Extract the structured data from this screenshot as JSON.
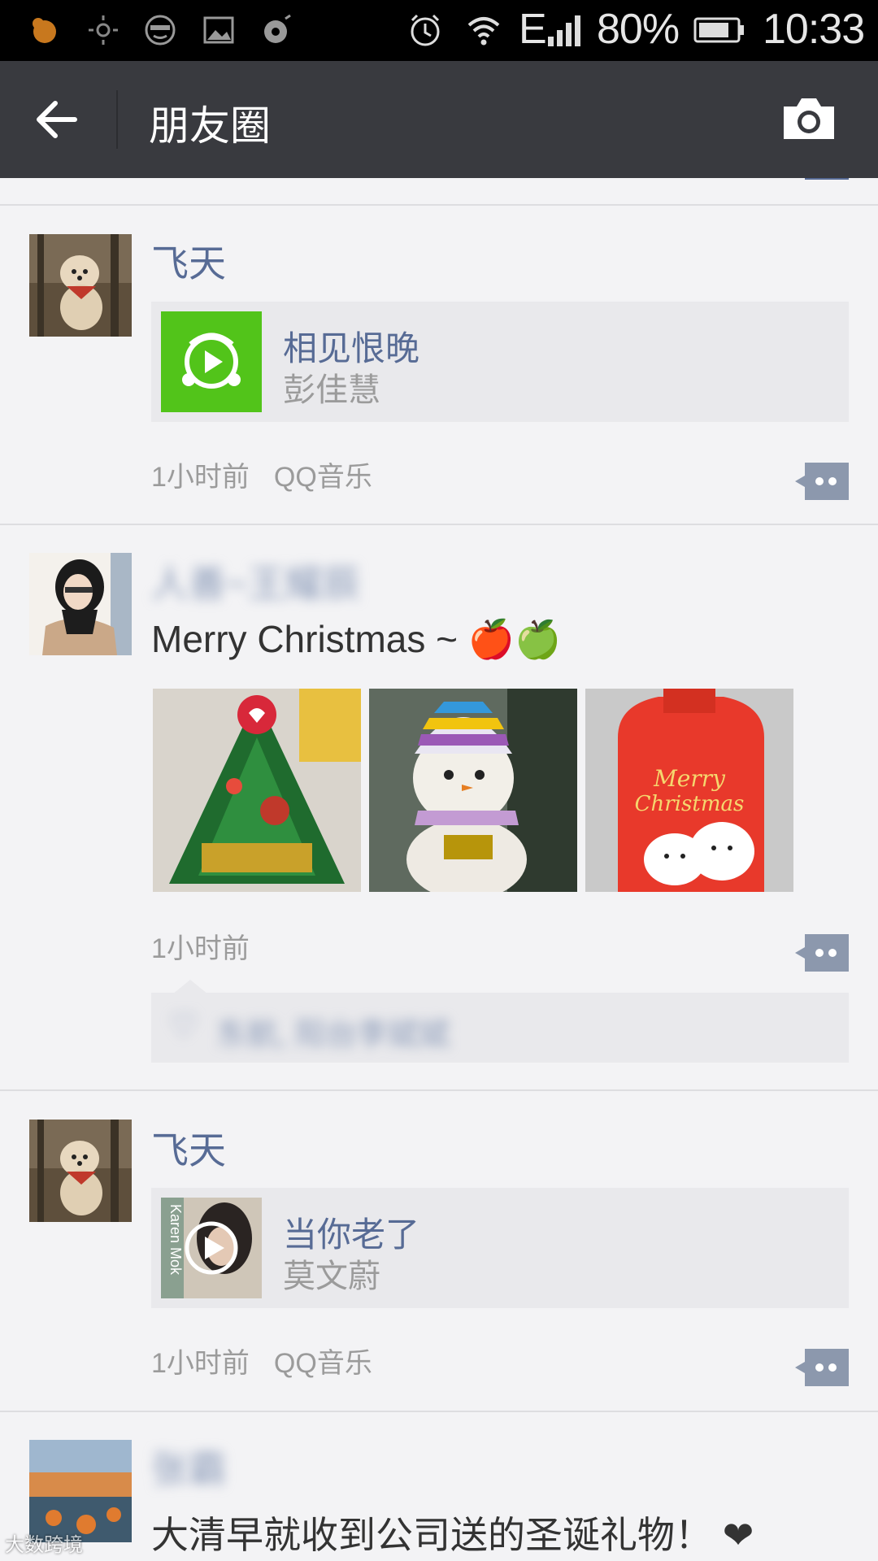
{
  "status_bar": {
    "network": "E",
    "battery": "80%",
    "time": "10:33"
  },
  "app_bar": {
    "title": "朋友圈"
  },
  "posts": [
    {
      "author": "飞天",
      "share": {
        "title": "相见恨晚",
        "subtitle": "彭佳慧",
        "icon": "music-play-icon"
      },
      "time": "1小时前",
      "source": "QQ音乐"
    },
    {
      "author": "人善~王耀辰",
      "text": "Merry Christmas ~ 🍎🍏",
      "photo_count": 3,
      "time": "1小时前",
      "likes": "东航, 阳台李斌斌"
    },
    {
      "author": "飞天",
      "share": {
        "title": "当你老了",
        "subtitle": "莫文蔚",
        "thumb_text": "Karen Mok"
      },
      "time": "1小时前",
      "source": "QQ音乐"
    },
    {
      "author": "张霸",
      "text": "大清早就收到公司送的圣诞礼物！ ❤"
    }
  ],
  "watermark": "大数跨境",
  "colors": {
    "app_bar": "#393a3f",
    "name_link": "#576b95",
    "music_green": "#52c41a",
    "background": "#f3f3f5"
  }
}
